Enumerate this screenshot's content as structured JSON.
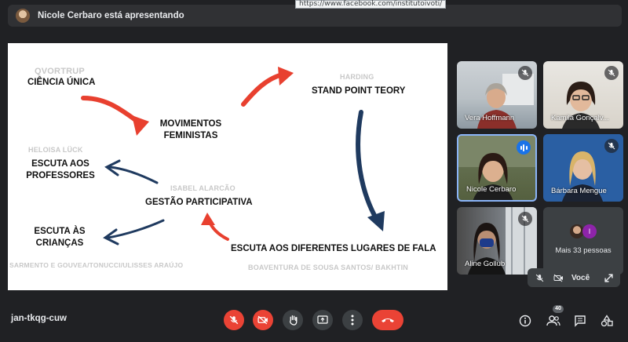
{
  "presenting": {
    "text": "Nicole Cerbaro está apresentando"
  },
  "url_tooltip": "https://www.facebook.com/institutoivoti/",
  "slide": {
    "qvortrup": "QVORTRUP",
    "ciencia_unica": "CIÊNCIA ÚNICA",
    "harding": "HARDING",
    "stand_point": "STAND POINT TEORY",
    "movimentos_1": "MOVIMENTOS",
    "movimentos_2": "FEMINISTAS",
    "heloisa": "HELOISA LÜCK",
    "escuta_prof_1": "ESCUTA AOS",
    "escuta_prof_2": "PROFESSORES",
    "isabel": "ISABEL ALARCÃO",
    "gestao": "GESTÃO PARTICIPATIVA",
    "escuta_cri_1": "ESCUTA ÀS",
    "escuta_cri_2": "CRIANÇAS",
    "sarmento": "SARMENTO E GOUVEA/TONUCCI/ULISSES ARAÚJO",
    "escuta_lugares": "ESCUTA AOS DIFERENTES LUGARES DE FALA",
    "boaventura": "BOAVENTURA DE SOUSA SANTOS/ BAKHTIN",
    "colors": {
      "red_arrow": "#e8402f",
      "navy_arrow": "#1f3a5f"
    }
  },
  "participants": [
    {
      "name": "Vera Hoffmann"
    },
    {
      "name": "Kamila Gonçalv..."
    },
    {
      "name": "Nicole Cerbaro"
    },
    {
      "name": "Bárbara Mengue"
    },
    {
      "name": "Aline Gollub"
    }
  ],
  "more_people": {
    "text": "Mais 33 pessoas",
    "avatar_letter": "I"
  },
  "self_view": {
    "label": "Você"
  },
  "meeting": {
    "code": "jan-tkqg-cuw",
    "participant_count": "40"
  }
}
